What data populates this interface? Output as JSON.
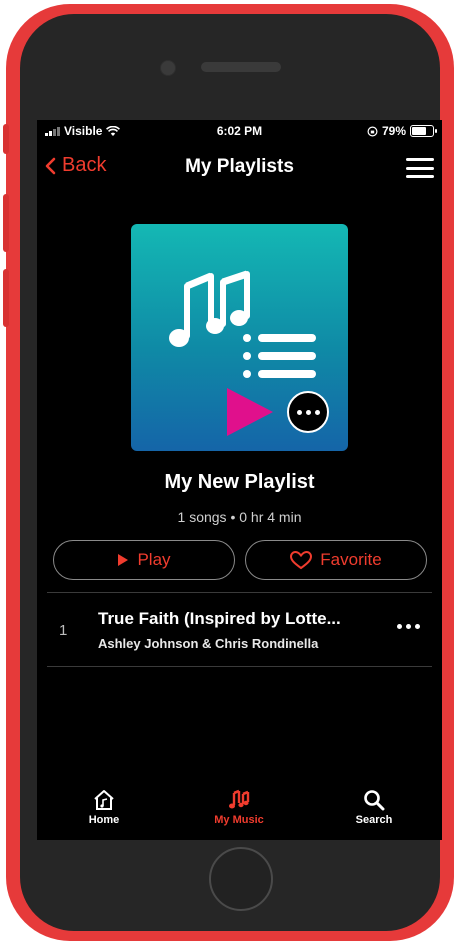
{
  "status_bar": {
    "carrier": "Visible",
    "time": "6:02 PM",
    "battery": "79%",
    "battery_level": 0.79
  },
  "nav": {
    "back_label": "Back",
    "title": "My Playlists"
  },
  "playlist": {
    "name": "My New Playlist",
    "meta": "1 songs • 0 hr 4 min"
  },
  "actions": {
    "play_label": "Play",
    "favorite_label": "Favorite"
  },
  "tracks": [
    {
      "number": "1",
      "title": "True Faith (Inspired by Lotte...",
      "artist": "Ashley Johnson & Chris Rondinella"
    }
  ],
  "tabs": [
    {
      "label": "Home",
      "icon": "home-music-icon",
      "active": false
    },
    {
      "label": "My Music",
      "icon": "music-notes-icon",
      "active": true
    },
    {
      "label": "Search",
      "icon": "search-icon",
      "active": false
    }
  ],
  "colors": {
    "accent": "#f03c2e",
    "pointer": "#e0108c",
    "phone_frame": "#e63a3a",
    "artwork_top": "#14b8b4",
    "artwork_bottom": "#1565a8"
  }
}
